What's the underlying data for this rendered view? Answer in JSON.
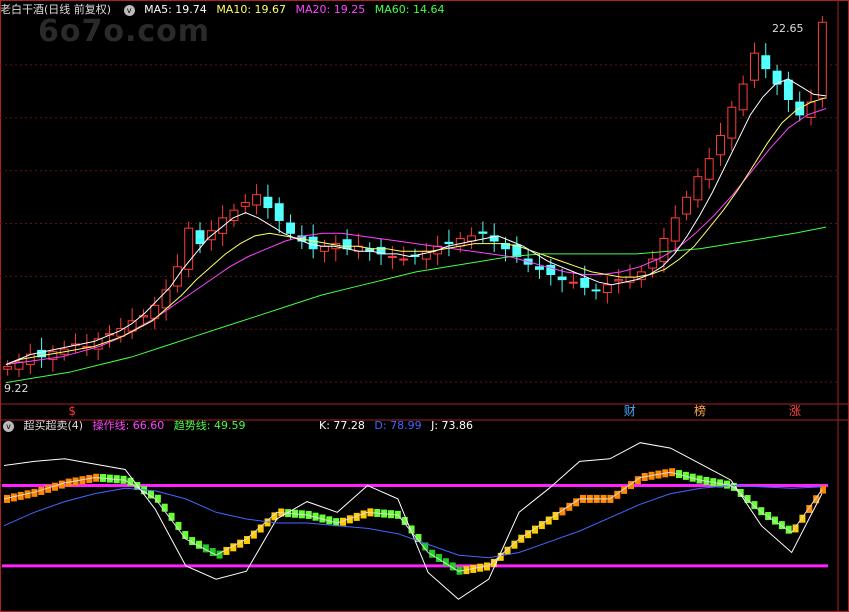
{
  "stock": {
    "title": "老白干酒",
    "period": "(日线 前复权)"
  },
  "watermark": "6o7o.com",
  "ma_labels": [
    {
      "text": "MA5: 19.74",
      "color": "#ffffff"
    },
    {
      "text": "MA10: 19.67",
      "color": "#ffff66"
    },
    {
      "text": "MA20: 19.25",
      "color": "#ff44ff"
    },
    {
      "text": "MA60: 14.64",
      "color": "#44ff44"
    }
  ],
  "indicator": {
    "name": "超买超卖(4)",
    "op_label": "操作线: 66.60",
    "op_color": "#ff44ff",
    "trend_label": "趋势线: 49.59",
    "trend_color": "#44ff44",
    "k": "K: 77.28",
    "d": "D: 78.99",
    "j": "J: 73.86",
    "k_color": "#ffffff",
    "d_color": "#4466ff",
    "j_color": "#ffffff"
  },
  "chart_data": [
    {
      "type": "candlestick",
      "name": "price",
      "price_range": [
        8,
        23
      ],
      "high_label": "22.65",
      "low_label": "9.22",
      "markers": [
        {
          "text": "$",
          "color": "#ff3333",
          "pos": 0.085
        },
        {
          "text": "财",
          "color": "#44aaff",
          "pos": 0.76
        },
        {
          "text": "榜",
          "color": "#ffaa44",
          "pos": 0.845
        },
        {
          "text": "涨",
          "color": "#ff4444",
          "pos": 0.96
        }
      ],
      "closes": [
        9.22,
        9.4,
        9.7,
        9.6,
        9.8,
        9.9,
        10.1,
        10.0,
        10.3,
        10.5,
        10.7,
        11.0,
        11.2,
        11.6,
        12.2,
        13.1,
        14.6,
        14.0,
        14.5,
        15.0,
        15.3,
        15.6,
        15.9,
        15.4,
        14.9,
        14.4,
        14.1,
        13.8,
        13.9,
        14.0,
        13.8,
        13.9,
        13.7,
        13.6,
        13.5,
        13.4,
        13.5,
        13.7,
        13.9,
        14.0,
        14.2,
        14.3,
        14.4,
        14.1,
        13.8,
        13.5,
        13.2,
        13.0,
        12.8,
        12.6,
        12.5,
        12.3,
        12.2,
        12.4,
        12.6,
        12.7,
        12.9,
        13.4,
        14.2,
        15.0,
        15.8,
        16.6,
        17.3,
        18.2,
        19.3,
        20.2,
        21.4,
        20.8,
        20.2,
        19.6,
        19.0,
        19.5,
        22.6
      ],
      "ma5": [
        9.3,
        9.5,
        9.7,
        9.8,
        9.9,
        10.0,
        10.1,
        10.2,
        10.4,
        10.6,
        10.9,
        11.3,
        11.8,
        12.3,
        13.0,
        13.6,
        14.2,
        14.6,
        15.0,
        15.2,
        15.0,
        14.7,
        14.4,
        14.2,
        14.0,
        13.9,
        13.9,
        13.8,
        13.7,
        13.7,
        13.6,
        13.6,
        13.5,
        13.6,
        13.7,
        13.9,
        14.0,
        14.1,
        14.2,
        14.3,
        14.1,
        13.9,
        13.6,
        13.3,
        13.1,
        12.9,
        12.7,
        12.5,
        12.4,
        12.5,
        12.6,
        12.8,
        13.1,
        13.6,
        14.3,
        15.1,
        16.0,
        17.0,
        18.0,
        19.0,
        19.7,
        20.2,
        20.4,
        20.1,
        19.8,
        19.74
      ],
      "ma10": [
        9.3,
        9.5,
        9.6,
        9.7,
        9.8,
        9.9,
        10.0,
        10.2,
        10.4,
        10.7,
        11.0,
        11.5,
        12.0,
        12.6,
        13.1,
        13.6,
        14.0,
        14.3,
        14.4,
        14.3,
        14.2,
        14.1,
        14.0,
        13.9,
        13.9,
        13.8,
        13.8,
        13.7,
        13.7,
        13.7,
        13.8,
        13.9,
        14.0,
        14.0,
        14.0,
        13.9,
        13.7,
        13.5,
        13.3,
        13.1,
        12.9,
        12.8,
        12.7,
        12.7,
        12.8,
        13.0,
        13.4,
        13.9,
        14.6,
        15.3,
        16.1,
        17.0,
        17.9,
        18.7,
        19.2,
        19.5,
        19.67
      ],
      "ma20": [
        9.3,
        9.4,
        9.5,
        9.6,
        9.8,
        10.0,
        10.3,
        10.7,
        11.1,
        11.6,
        12.1,
        12.6,
        13.1,
        13.5,
        13.8,
        14.1,
        14.3,
        14.4,
        14.4,
        14.3,
        14.2,
        14.1,
        14.0,
        13.9,
        13.8,
        13.7,
        13.6,
        13.5,
        13.3,
        13.1,
        12.9,
        12.8,
        12.8,
        12.9,
        13.1,
        13.4,
        13.8,
        14.4,
        15.1,
        15.9,
        16.8,
        17.7,
        18.5,
        19.0,
        19.25
      ],
      "ma60": [
        8.6,
        8.8,
        9.0,
        9.3,
        9.6,
        10.0,
        10.4,
        10.8,
        11.2,
        11.6,
        12.0,
        12.3,
        12.6,
        12.9,
        13.1,
        13.3,
        13.5,
        13.6,
        13.6,
        13.6,
        13.6,
        13.7,
        13.8,
        14.0,
        14.2,
        14.4,
        14.64
      ]
    },
    {
      "type": "line",
      "name": "oscillator",
      "ylim": [
        -10,
        120
      ],
      "upper_line": 80,
      "lower_line": 20,
      "k": [
        70,
        75,
        82,
        86,
        84,
        70,
        40,
        28,
        40,
        60,
        58,
        52,
        60,
        58,
        30,
        16,
        20,
        40,
        55,
        70,
        70,
        86,
        90,
        84,
        80,
        60,
        45,
        77
      ],
      "d": [
        50,
        60,
        68,
        74,
        78,
        76,
        70,
        60,
        55,
        52,
        52,
        50,
        48,
        44,
        36,
        28,
        26,
        30,
        38,
        46,
        56,
        66,
        74,
        78,
        80,
        79,
        78,
        79
      ],
      "j": [
        95,
        98,
        100,
        96,
        92,
        62,
        20,
        10,
        16,
        55,
        68,
        60,
        80,
        70,
        15,
        -5,
        10,
        60,
        78,
        98,
        100,
        112,
        108,
        96,
        84,
        50,
        30,
        74
      ]
    }
  ]
}
